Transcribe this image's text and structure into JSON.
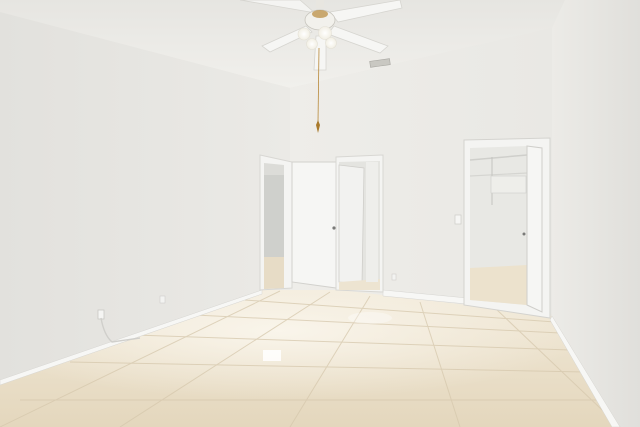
{
  "scene": {
    "subject": "empty-bedroom",
    "elements": [
      "ceiling-fan",
      "ceiling-vent",
      "bedroom-door-left",
      "bedroom-door-middle",
      "closet-doorway",
      "walk-in-closet",
      "tile-floor",
      "electrical-outlet",
      "light-switch",
      "baseboard"
    ]
  },
  "colors": {
    "ceiling": "#efeeea",
    "wall_left": "#e8e7e3",
    "wall_back": "#eeede9",
    "wall_right": "#e6e5e1",
    "floor": "#ece1cb",
    "floor_grout": "#d9ccb2",
    "baseboard": "#f7f7f5",
    "door": "#f4f4f2",
    "fan_blade": "#f6f6f4",
    "fan_brass": "#b8893a"
  }
}
